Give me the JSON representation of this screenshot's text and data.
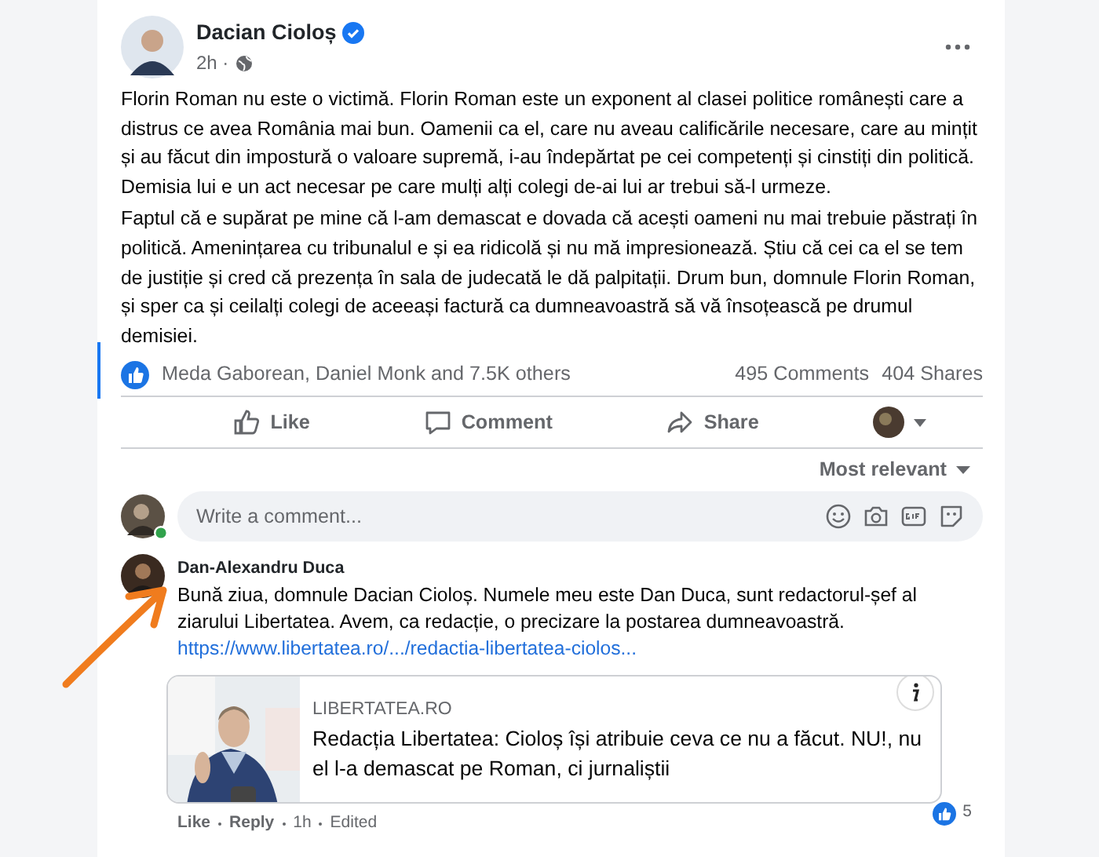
{
  "post": {
    "author": "Dacian Cioloș",
    "verified": true,
    "time": "2h ·",
    "paragraphs": [
      "Florin Roman nu este o victimă. Florin Roman este un exponent al clasei politice românești care a distrus ce avea România mai bun. Oamenii ca el, care nu aveau calificările necesare, care au mințit și au făcut din impostură o valoare supremă, i-au îndepărtat pe cei competenți și cinstiți din politică. Demisia lui e un act necesar pe care mulți alți colegi de-ai lui ar trebui să-l urmeze.",
      "Faptul că e supărat pe mine că l-am demascat e dovada că acești oameni nu mai trebuie păstrați în politică. Amenințarea cu tribunalul e și ea ridicolă și nu mă impresionează. Știu că cei ca el se tem de justiție și cred că prezența în sala de judecată le dă palpitații. Drum bun, domnule Florin Roman, și sper ca și ceilalți colegi de aceeași factură ca dumneavoastră să vă însoțească pe drumul demisiei."
    ],
    "reactions": "Meda Gaborean, Daniel Monk and 7.5K others",
    "comments": "495 Comments",
    "shares": "404 Shares",
    "actions": [
      {
        "kind": "like",
        "label": "Like"
      },
      {
        "kind": "comment",
        "label": "Comment"
      },
      {
        "kind": "share",
        "label": "Share"
      }
    ],
    "sort": "Most relevant"
  },
  "comment_box": {
    "placeholder": "Write a comment...",
    "online": true
  },
  "comments": [
    {
      "author": "Dan-Alexandru Duca",
      "text": "Bună ziua, domnule Dacian Cioloș. Numele meu este Dan Duca, sunt redactorul-șef al ziarului Libertatea. Avem, ca redacție, o precizare la postarea dumneavoastră.",
      "link": "https://www.libertatea.ro/.../redactia-libertatea-ciolos...",
      "preview": {
        "domain": "LIBERTATEA.RO",
        "title": "Redacția Libertatea: Cioloș își atribuie ceva ce nu a făcut. NU!, nu el l-a demascat pe Roman, ci jurnaliștii"
      },
      "footer": [
        "Like",
        "Reply",
        "1h",
        "Edited"
      ],
      "reaction_count": "5"
    }
  ]
}
